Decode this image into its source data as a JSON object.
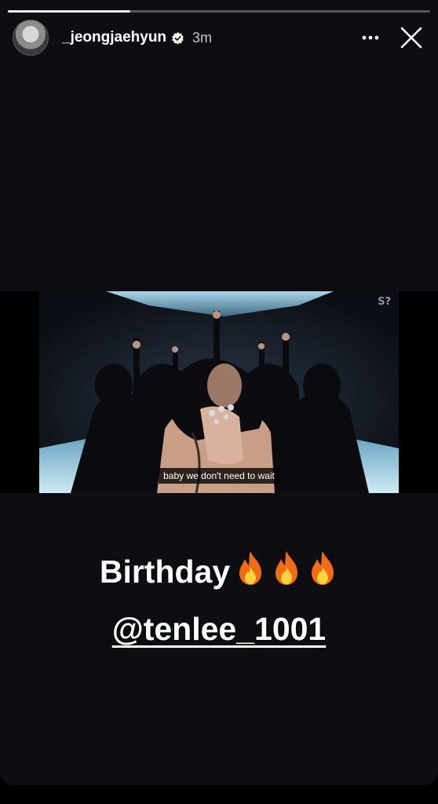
{
  "story": {
    "progress": 0.29,
    "username": "_jeongjaehyun",
    "time_ago": "3m",
    "verified": true,
    "icons": {
      "avatar": "profile-avatar",
      "verified": "verified-badge-icon",
      "more": "more-options-icon",
      "close": "close-icon"
    }
  },
  "video": {
    "logo": "S?",
    "subtitle": "baby we don't need to wait"
  },
  "caption": {
    "line1": "Birthday",
    "emoji": "fire-icon",
    "emoji_count": 3,
    "mention": "@tenlee_1001"
  },
  "colors": {
    "background": "#0d0e12",
    "text": "#ffffff",
    "fire_outer": "#f36b12",
    "fire_inner": "#ffd23f"
  }
}
